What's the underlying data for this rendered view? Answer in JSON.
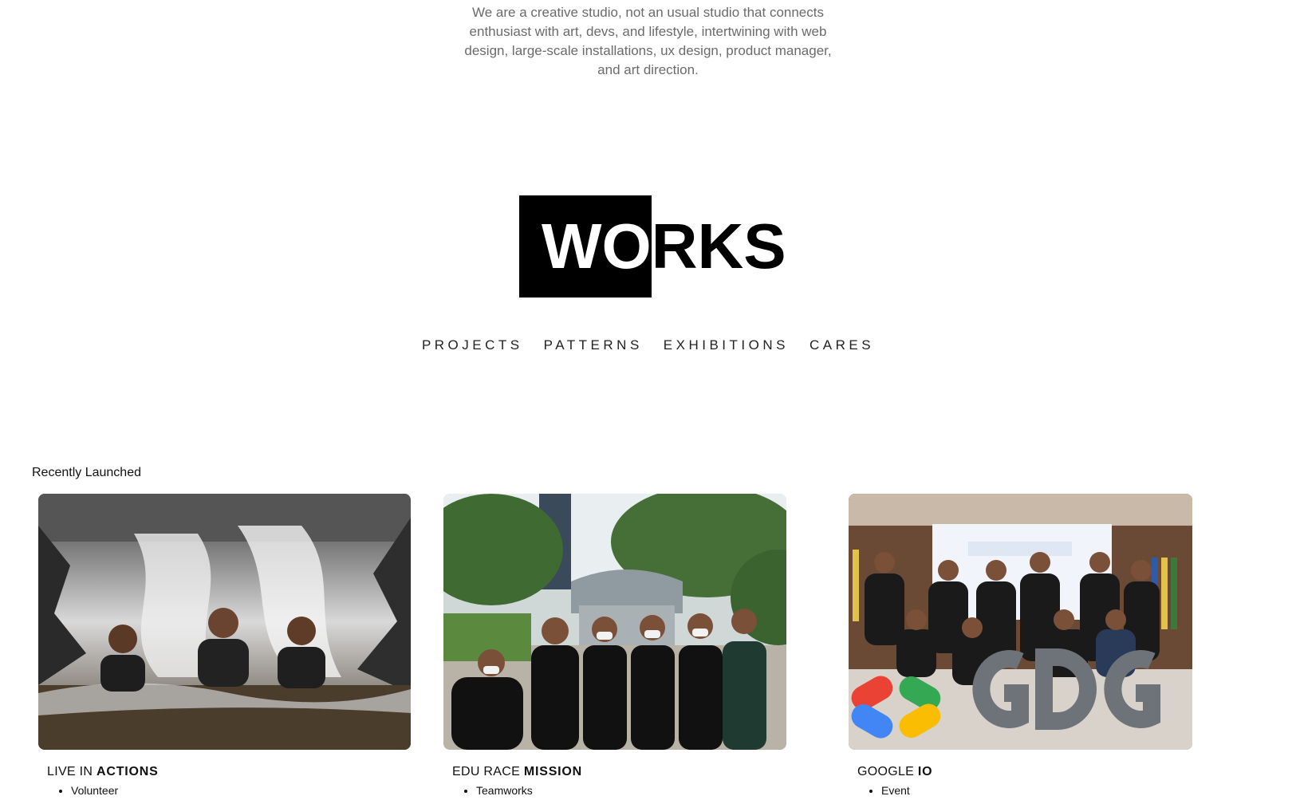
{
  "intro": {
    "text": "We are a creative studio, not an usual studio that connects enthusiast with art, devs, and lifestyle, intertwining with web design, large-scale installations, ux design, product manager, and art direction."
  },
  "logo": {
    "inverted_part": "WO",
    "rest_part": "RKS"
  },
  "nav": {
    "items": [
      {
        "label": "PROJECTS"
      },
      {
        "label": "PATTERNS"
      },
      {
        "label": "EXHIBITIONS"
      },
      {
        "label": "CARES"
      }
    ]
  },
  "recent": {
    "heading": "Recently Launched",
    "cards": [
      {
        "title_prefix": "LIVE IN",
        "title_bold": "ACTIONS",
        "tag": "Volunteer"
      },
      {
        "title_prefix": "EDU RACE",
        "title_bold": "MISSION",
        "tag": "Teamworks"
      },
      {
        "title_prefix": "GOOGLE",
        "title_bold": "IO",
        "tag": "Event"
      }
    ]
  }
}
